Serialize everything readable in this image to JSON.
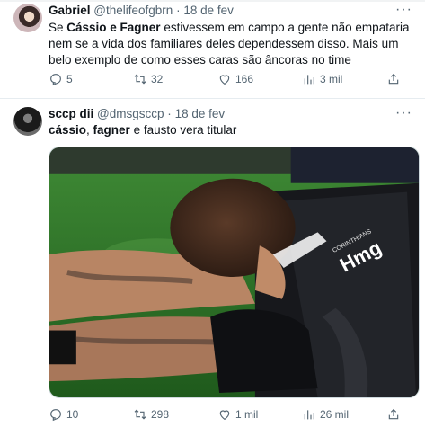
{
  "tweets": [
    {
      "name": "Gabriel",
      "handle": "@thelifeofgbrn",
      "separator": "·",
      "date": "18 de fev",
      "text_parts": {
        "p1": "Se ",
        "b1": "Cássio e Fagner",
        "p2": " estivessem em campo a gente não empataria nem se a vida dos familiares deles dependessem disso. Mais um belo exemplo de como esses caras são âncoras no time"
      },
      "replies": "5",
      "retweets": "32",
      "likes": "166",
      "views": "3 mil"
    },
    {
      "name": "sccp dii",
      "handle": "@dmsgsccp",
      "separator": "·",
      "date": "18 de fev",
      "text_parts": {
        "b1": "cássio",
        "p1": ", ",
        "b2": "fagner",
        "p2": " e ",
        "p3": "fausto vera titular"
      },
      "replies": "10",
      "retweets": "298",
      "likes": "1 mil",
      "views": "26 mil",
      "media": {
        "jersey_text": "Hmg",
        "jersey_sub": "CORINTHIANS"
      }
    }
  ],
  "icons": [
    "more-icon",
    "reply-icon",
    "retweet-icon",
    "like-icon",
    "views-icon",
    "share-icon"
  ],
  "colors": {
    "text": "#0f1419",
    "secondary": "#536471",
    "divider": "#e6ecf0"
  }
}
